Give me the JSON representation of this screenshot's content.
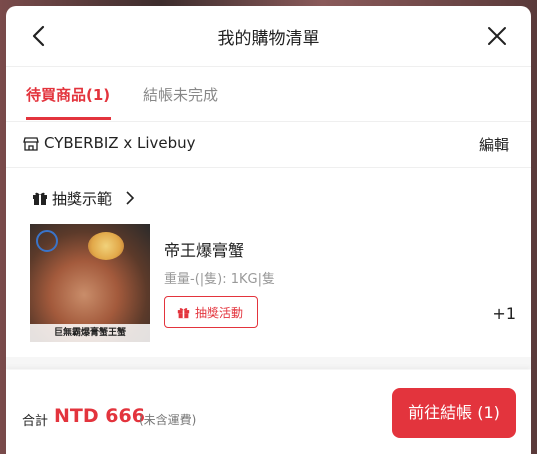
{
  "header": {
    "title": "我的購物清單"
  },
  "tabs": [
    {
      "label": "待買商品(1)",
      "active": true
    },
    {
      "label": "結帳未完成",
      "active": false
    }
  ],
  "store": {
    "name": "CYBERBIZ x Livebuy",
    "edit_label": "編輯"
  },
  "promo": {
    "label": "抽獎示範"
  },
  "product": {
    "name": "帝王爆膏蟹",
    "spec": "重量-(|隻): 1KG|隻",
    "lottery_label": "抽獎活動",
    "qty": "+1",
    "image_caption": "巨無霸爆膏蟹王蟹"
  },
  "footer": {
    "total_label": "合計",
    "total_amount": "NTD 666",
    "shipping_note": "(未含運費)",
    "checkout_label": "前往結帳 (1)"
  },
  "colors": {
    "accent": "#e3343d"
  },
  "icons": [
    "back-arrow-icon",
    "close-icon",
    "store-icon",
    "gift-icon",
    "chevron-right-icon"
  ]
}
